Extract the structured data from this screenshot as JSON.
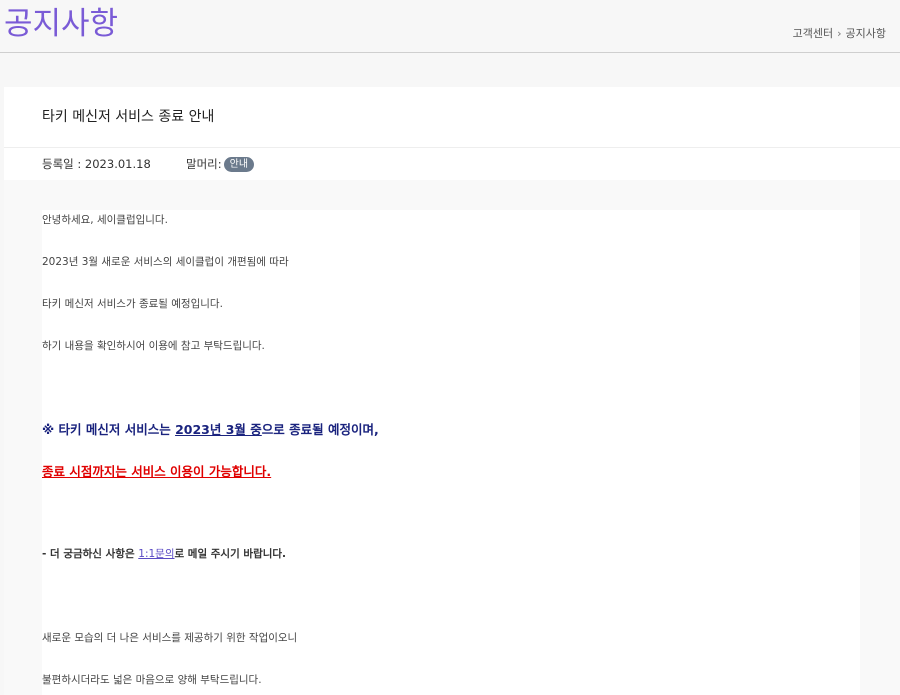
{
  "header": {
    "title": "공지사항",
    "breadcrumb": [
      "고객센터",
      "공지사항"
    ],
    "breadcrumb_sep": "›"
  },
  "notice": {
    "title": "타키 메신저 서비스 종료 안내",
    "date_label": "등록일 : 2023.01.18",
    "category_label": "말머리:",
    "category_badge": "안내"
  },
  "content": {
    "line1": "안녕하세요, 세이클럽입니다.",
    "line2": "2023년 3월 새로운 서비스의 세이클럽이 개편됨에 따라",
    "line3": "타키 메신저 서비스가 종료될 예정입니다.",
    "line4": "하기 내용을 확인하시어 이용에 참고 부탁드립니다.",
    "emph1_prefix": "※ 타키 메신저 서비스는 ",
    "emph1_date": "2023년 3월 중",
    "emph1_suffix": "으로 종료될 예정이며,",
    "emph2": "종료 시점까지는 서비스 이용이 가능합니다.",
    "contact_prefix": "- 더 궁금하신 사항은 ",
    "contact_link": "1:1문의",
    "contact_suffix": "로 메일 주시기 바랍니다.",
    "line5": "새로운 모습의 더 나은 서비스를 제공하기 위한 작업이오니",
    "line6": "불편하시더라도 넓은 마음으로 양해 부탁드립니다."
  },
  "colors": {
    "title_purple": "#7a5bd6",
    "emph_blue": "#1a237e",
    "emph_red": "#e00000",
    "badge_gray": "#6b7a8c"
  }
}
